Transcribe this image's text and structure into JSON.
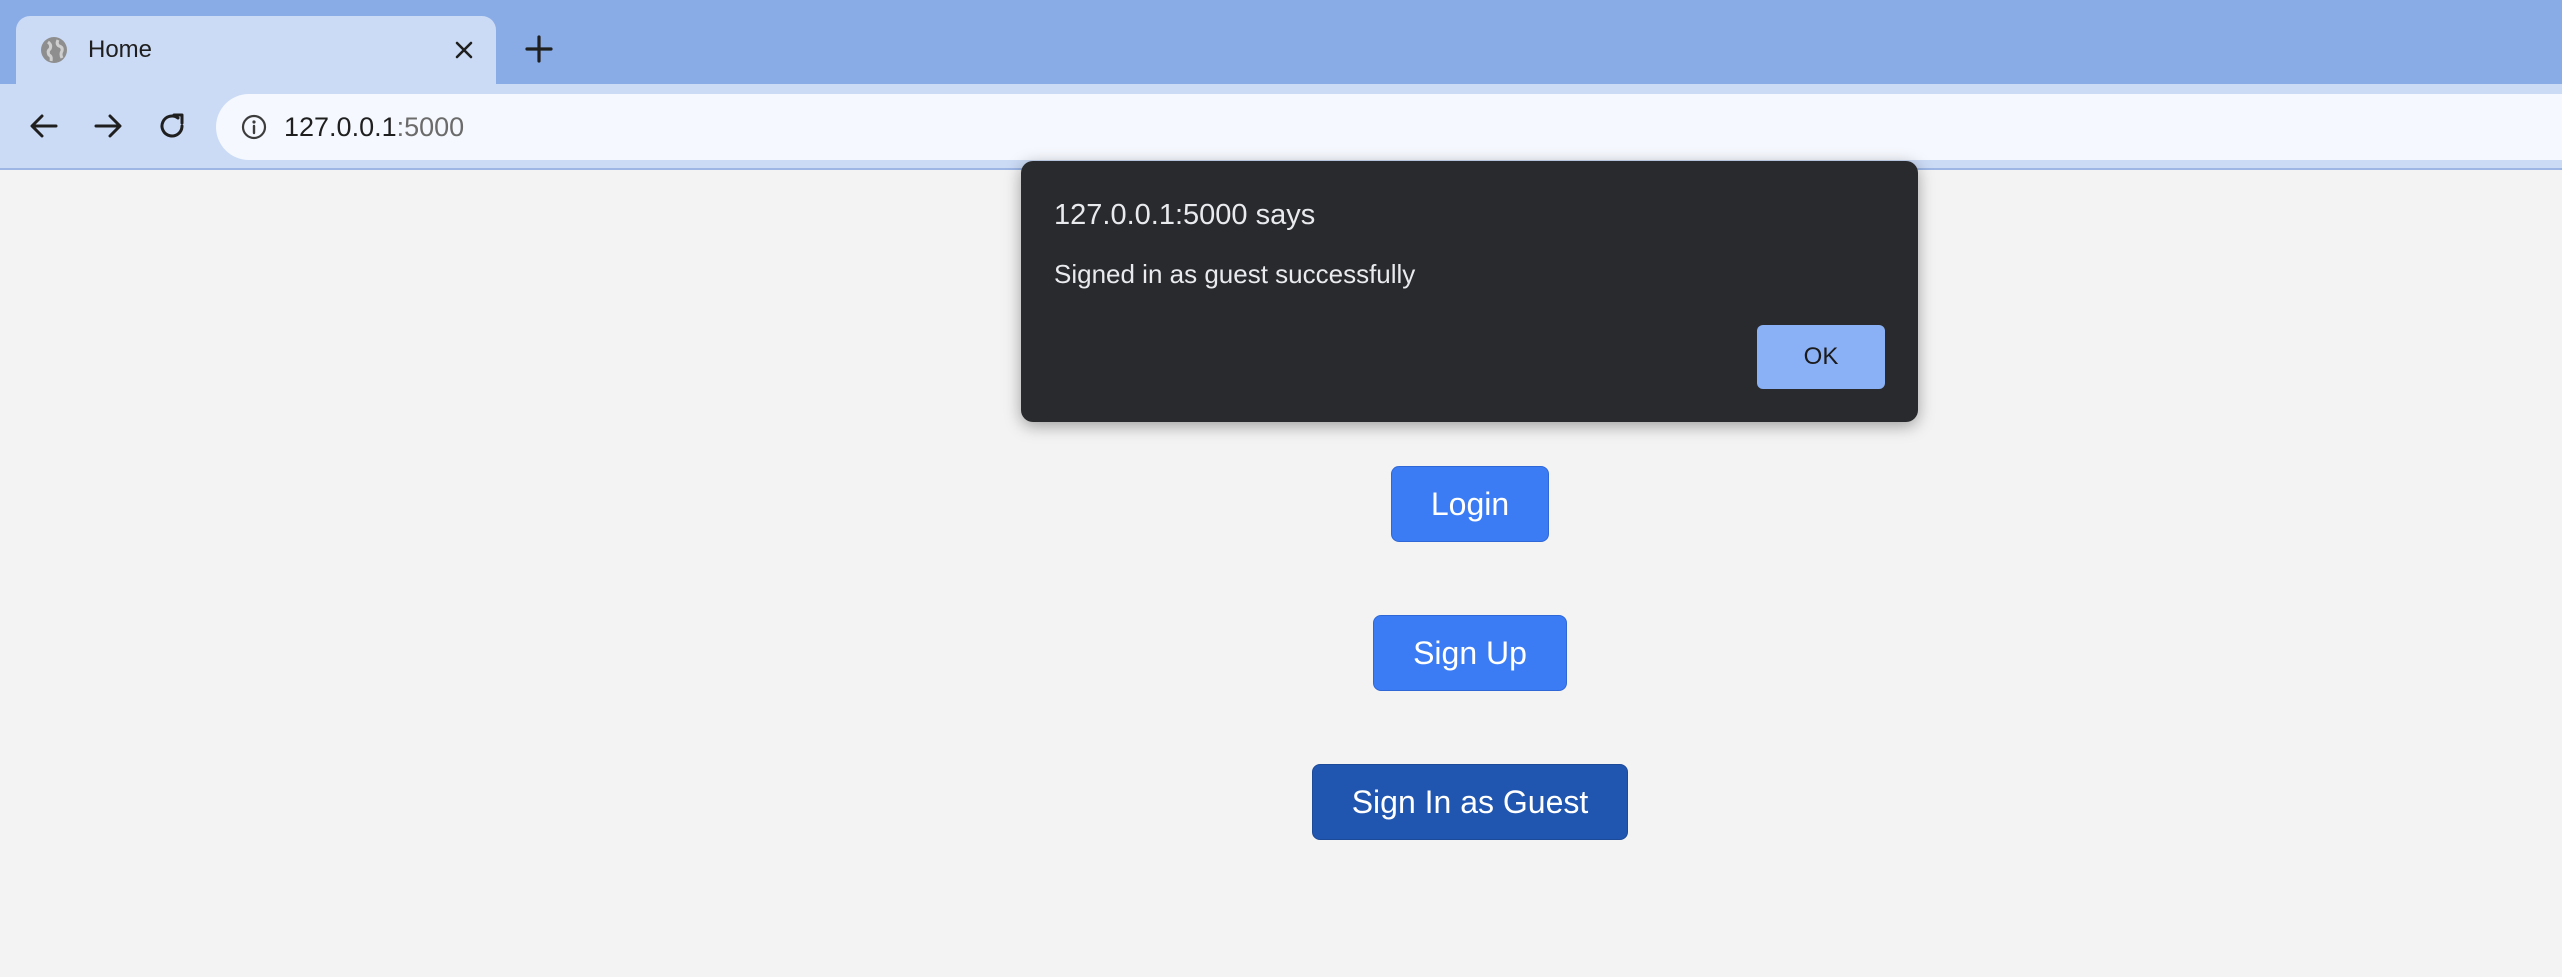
{
  "browser": {
    "tab": {
      "title": "Home",
      "favicon": "globe-icon",
      "close_icon": "close-icon"
    },
    "new_tab_icon": "plus-icon",
    "nav": {
      "back_icon": "arrow-left-icon",
      "forward_icon": "arrow-right-icon",
      "reload_icon": "reload-icon"
    },
    "omnibox": {
      "info_icon": "info-icon",
      "url_host": "127.0.0.1",
      "url_port": ":5000"
    }
  },
  "page": {
    "buttons": {
      "login": "Login",
      "signup": "Sign Up",
      "guest": "Sign In as Guest"
    }
  },
  "dialog": {
    "title": "127.0.0.1:5000 says",
    "message": "Signed in as guest successfully",
    "ok_label": "OK"
  },
  "colors": {
    "tabstrip": "#8aace6",
    "toolbar": "#cbdaf5",
    "primary_button": "#3b7cf5",
    "guest_button": "#2156b0",
    "dialog_bg": "#292a2d",
    "dialog_ok": "#8ab0f5"
  }
}
